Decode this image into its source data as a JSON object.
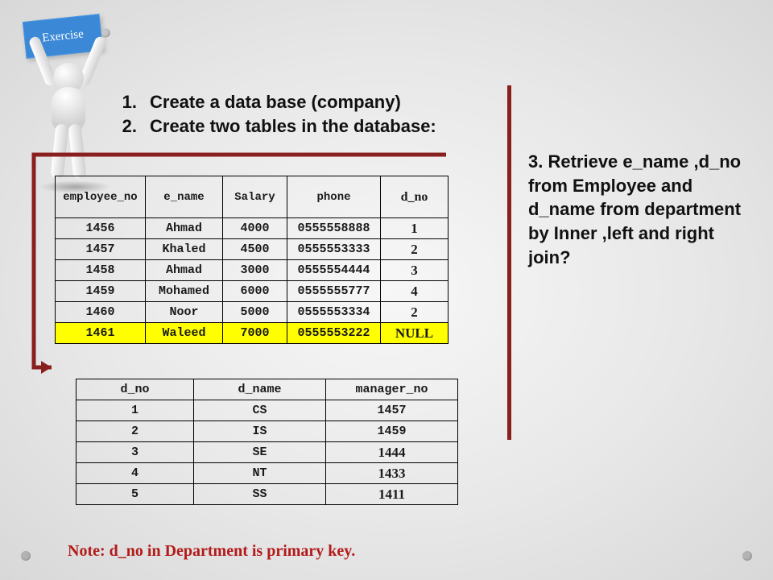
{
  "badge": "Exercise",
  "list": {
    "item1_num": "1.",
    "item1_txt": "Create a data base (company)",
    "item2_num": "2.",
    "item2_txt": "Create two tables in the database:"
  },
  "right_question": "3. Retrieve e_name ,d_no from Employee and d_name from department by Inner ,left and right join?",
  "table1": {
    "headers": {
      "c1": "employee_no",
      "c2": "e_name",
      "c3": "Salary",
      "c4": "phone",
      "c5": "d_no"
    },
    "rows": [
      {
        "c1": "1456",
        "c2": "Ahmad",
        "c3": "4000",
        "c4": "0555558888",
        "c5": "1",
        "hl": false
      },
      {
        "c1": "1457",
        "c2": "Khaled",
        "c3": "4500",
        "c4": "0555553333",
        "c5": "2",
        "hl": false
      },
      {
        "c1": "1458",
        "c2": "Ahmad",
        "c3": "3000",
        "c4": "0555554444",
        "c5": "3",
        "hl": false
      },
      {
        "c1": "1459",
        "c2": "Mohamed",
        "c3": "6000",
        "c4": "0555555777",
        "c5": "4",
        "hl": false
      },
      {
        "c1": "1460",
        "c2": "Noor",
        "c3": "5000",
        "c4": "0555553334",
        "c5": "2",
        "hl": false
      },
      {
        "c1": "1461",
        "c2": "Waleed",
        "c3": "7000",
        "c4": "0555553222",
        "c5": "NULL",
        "hl": true
      }
    ]
  },
  "table2": {
    "headers": {
      "d1": "d_no",
      "d2": "d_name",
      "d3": "manager_no"
    },
    "rows": [
      {
        "d1": "1",
        "d2": "CS",
        "d3": "1457",
        "serif3": false
      },
      {
        "d1": "2",
        "d2": "IS",
        "d3": "1459",
        "serif3": false
      },
      {
        "d1": "3",
        "d2": "SE",
        "d3": "1444",
        "serif3": true
      },
      {
        "d1": "4",
        "d2": "NT",
        "d3": "1433",
        "serif3": true
      },
      {
        "d1": "5",
        "d2": "SS",
        "d3": "1411",
        "serif3": true
      }
    ]
  },
  "note": "Note:  d_no in Department is  primary key.",
  "colors": {
    "accent": "#8a1f1f",
    "sign": "#3a88d6",
    "highlight": "#ffff00",
    "note": "#b31a1a"
  }
}
